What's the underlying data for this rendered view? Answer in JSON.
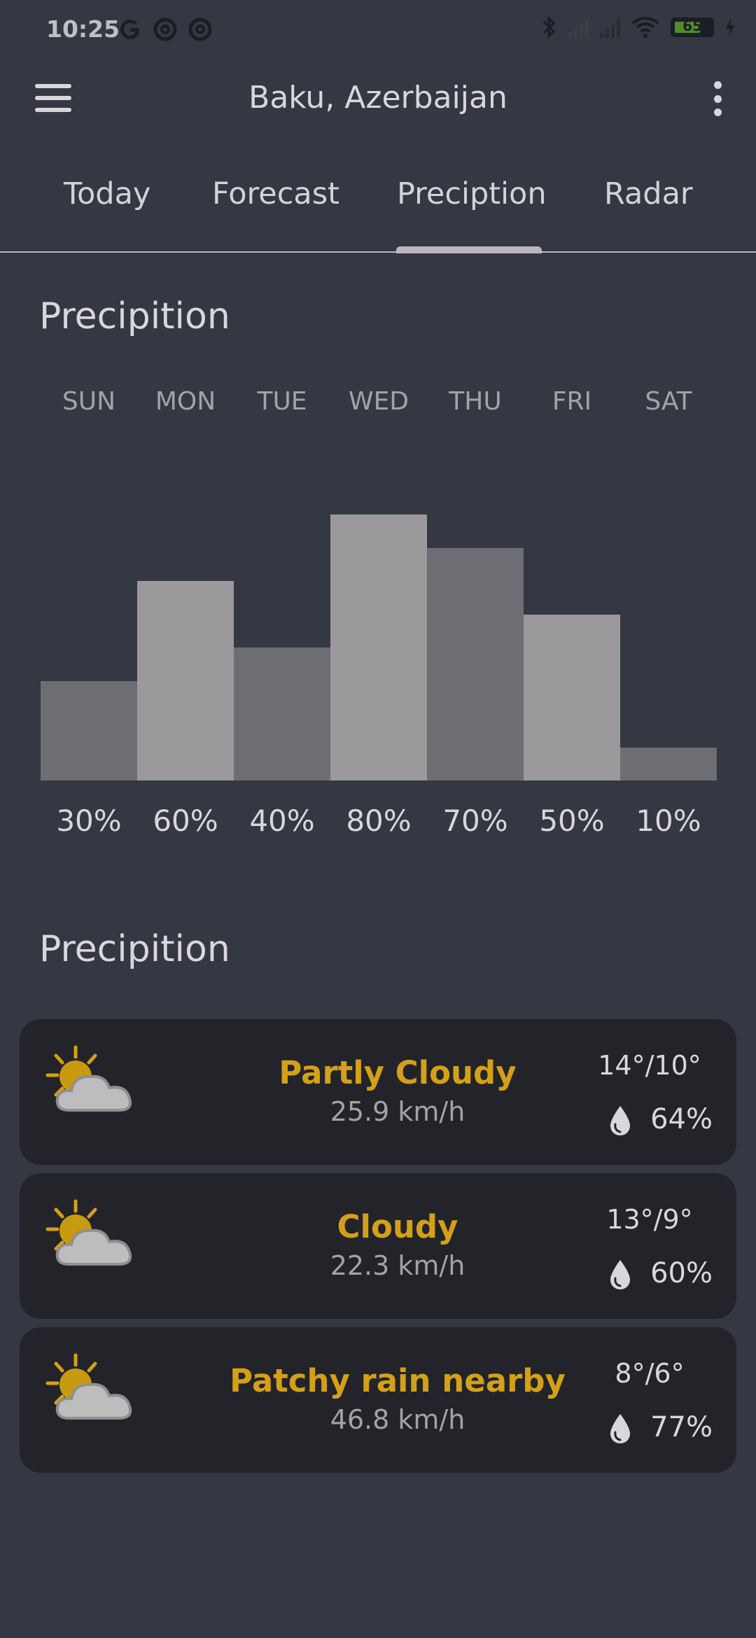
{
  "status_bar": {
    "time": "10:25",
    "battery": "65",
    "icons": [
      "google-icon",
      "sync-icon",
      "sync-icon",
      "bluetooth-icon",
      "signal-icon",
      "signal-icon",
      "wifi-icon",
      "battery-icon",
      "charging-icon"
    ]
  },
  "app_bar": {
    "title": "Baku, Azerbaijan",
    "menu_icon": "menu-icon",
    "more_icon": "more-vert-icon"
  },
  "tabs": [
    {
      "label": "Today"
    },
    {
      "label": "Forecast"
    },
    {
      "label": "Preciption"
    },
    {
      "label": "Radar"
    }
  ],
  "selected_tab": "Preciption",
  "chart_section": {
    "title": "Precipition",
    "days": [
      "SUN",
      "MON",
      "TUE",
      "WED",
      "THU",
      "FRI",
      "SAT"
    ]
  },
  "chart_data": {
    "type": "bar",
    "categories": [
      "SUN",
      "MON",
      "TUE",
      "WED",
      "THU",
      "FRI",
      "SAT"
    ],
    "values": [
      30,
      60,
      40,
      80,
      70,
      50,
      10
    ],
    "labels": [
      "30%",
      "60%",
      "40%",
      "80%",
      "70%",
      "50%",
      "10%"
    ],
    "bar_colors": [
      "#6d6e72",
      "#9a9a9c",
      "#6d6e72",
      "#9a9a9c",
      "#6d6e72",
      "#9a9a9c",
      "#6d6e72"
    ]
  },
  "list_section": {
    "title": "Precipition"
  },
  "forecast": [
    {
      "condition": "Partly Cloudy",
      "wind": "25.9 km/h",
      "temps": "14°/10°",
      "humidity": "64%",
      "icon": "partly-cloudy-icon"
    },
    {
      "condition": "Cloudy",
      "wind": "22.3 km/h",
      "temps": "13°/9°",
      "humidity": "60%",
      "icon": "partly-cloudy-icon"
    },
    {
      "condition": "Patchy rain nearby",
      "wind": "46.8 km/h",
      "temps": "8°/6°",
      "humidity": "77%",
      "icon": "partly-cloudy-icon"
    }
  ],
  "colors": {
    "background": "#353743",
    "card": "#23242a",
    "accent": "#d4a017"
  }
}
